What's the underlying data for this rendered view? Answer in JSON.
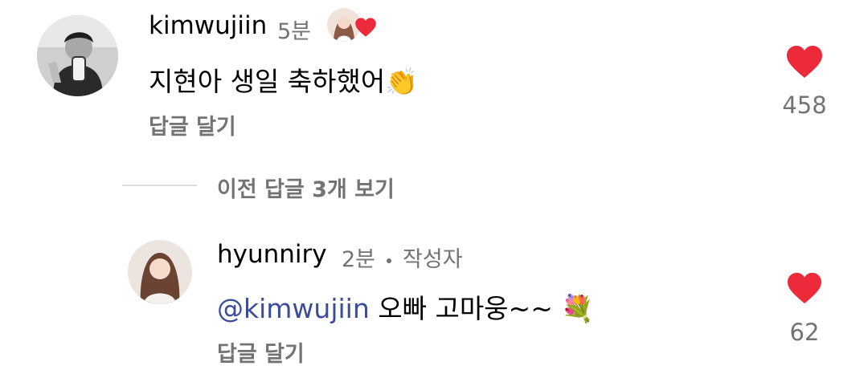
{
  "colors": {
    "like": "#ed4956",
    "secondary_text": "#737373",
    "mention": "#3b4c9b",
    "divider": "#dbdbdb"
  },
  "comment": {
    "username": "kimwujiin",
    "time": "5분",
    "text": "지현아 생일 축하했어",
    "emoji": "👏",
    "reply_label": "답글 달기",
    "like_count": "458",
    "avatar_icon": "user-avatar-bw",
    "liked_by_author_icon": "author-liked-heart"
  },
  "thread": {
    "view_previous_label": "이전 답글 3개 보기"
  },
  "reply": {
    "username": "hyunniry",
    "time": "2분",
    "author_badge": "작성자",
    "mention": "@kimwujiin",
    "text": "오빠 고마웅~~",
    "emoji": "💐",
    "reply_label": "답글 달기",
    "like_count": "62",
    "avatar_icon": "user-avatar"
  }
}
